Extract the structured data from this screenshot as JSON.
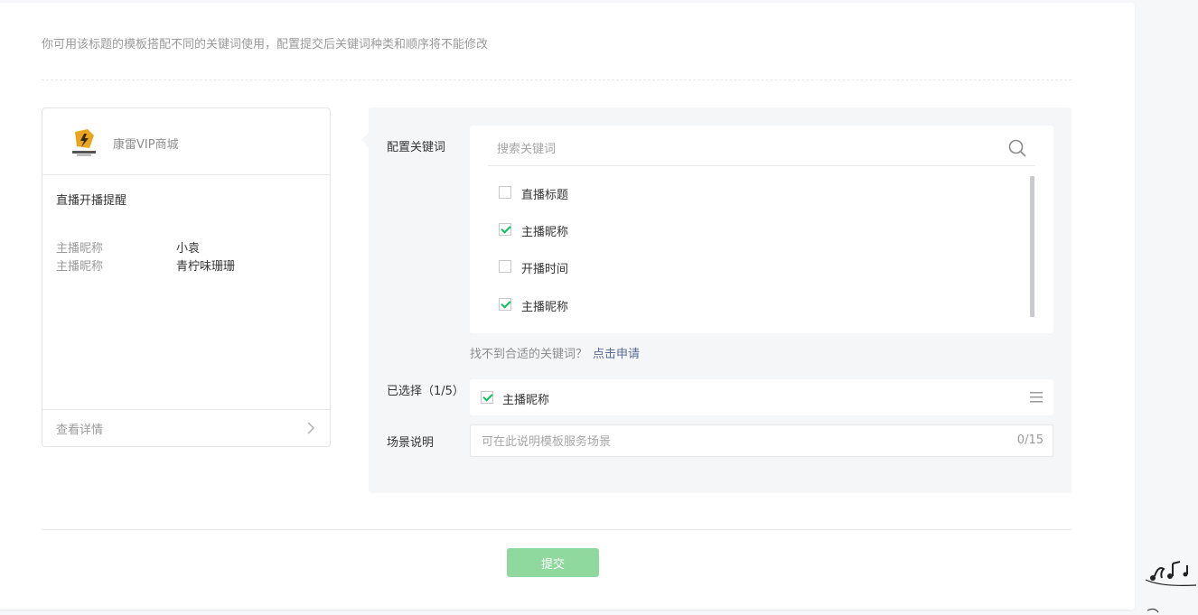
{
  "tip": "你可用该标题的模板搭配不同的关键词使用，配置提交后关键词种类和顺序将不能修改",
  "preview": {
    "brand_name": "康雷VIP商城",
    "title": "直播开播提醒",
    "rows": [
      {
        "label": "主播昵称",
        "value": "小袁"
      },
      {
        "label": "主播昵称",
        "value": "青柠味珊珊"
      }
    ],
    "detail_link": "查看详情"
  },
  "config": {
    "keywords_label": "配置关键词",
    "search_placeholder": "搜索关键词",
    "keywords": [
      {
        "label": "直播标题",
        "checked": false
      },
      {
        "label": "主播昵称",
        "checked": true
      },
      {
        "label": "开播时间",
        "checked": false
      },
      {
        "label": "主播昵称",
        "checked": true
      }
    ],
    "hint_text": "找不到合适的关键词？",
    "hint_link": "点击申请",
    "selected_label": "已选择（1/5）",
    "selected_items": [
      {
        "label": "主播昵称",
        "checked": true
      }
    ],
    "scene_label": "场景说明",
    "scene_placeholder": "可在此说明模板服务场景",
    "scene_count": "0/15"
  },
  "submit_label": "提交",
  "colors": {
    "accent_green": "#07c160",
    "submit_disabled": "#8fd99f",
    "link_blue": "#576b95"
  }
}
